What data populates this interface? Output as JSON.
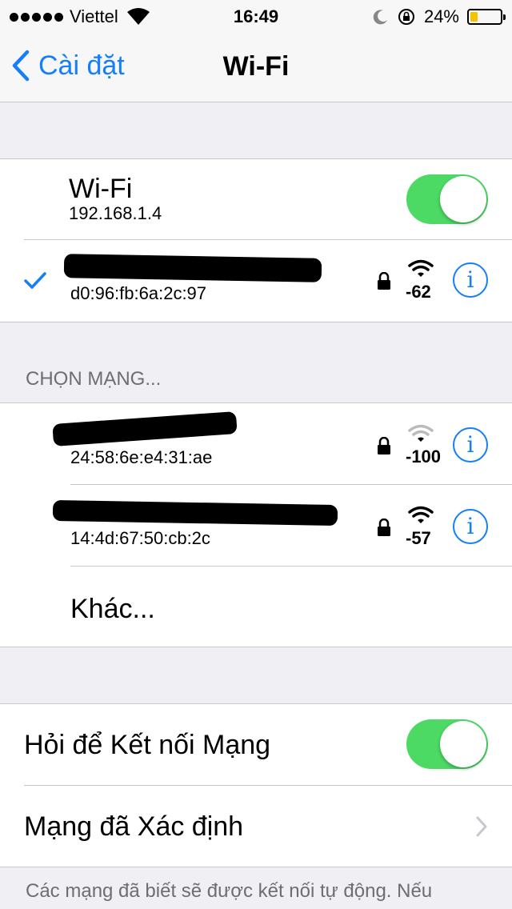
{
  "status_bar": {
    "carrier": "Viettel",
    "time": "16:49",
    "battery": "24%",
    "battery_level": 0.24
  },
  "nav": {
    "back_label": "Cài đặt",
    "title": "Wi-Fi"
  },
  "wifi_main": {
    "label": "Wi-Fi",
    "ip": "192.168.1.4",
    "enabled": true
  },
  "connected": {
    "mac": "d0:96:fb:6a:2c:97",
    "rssi": "-62",
    "info": "i"
  },
  "networks_header": "CHỌN MẠNG...",
  "networks": [
    {
      "mac": "24:58:6e:e4:31:ae",
      "rssi": "-100",
      "info": "i"
    },
    {
      "mac": "14:4d:67:50:cb:2c",
      "rssi": "-57",
      "info": "i"
    }
  ],
  "other_label": "Khác...",
  "ask_join": {
    "label": "Hỏi để Kết nối Mạng",
    "enabled": true
  },
  "known_networks": {
    "label": "Mạng đã Xác định"
  },
  "footer_text": "Các mạng đã biết sẽ được kết nối tự động. Nếu",
  "colors": {
    "accent": "#157efb",
    "toggle_on": "#4cd964",
    "background": "#efeff4"
  }
}
